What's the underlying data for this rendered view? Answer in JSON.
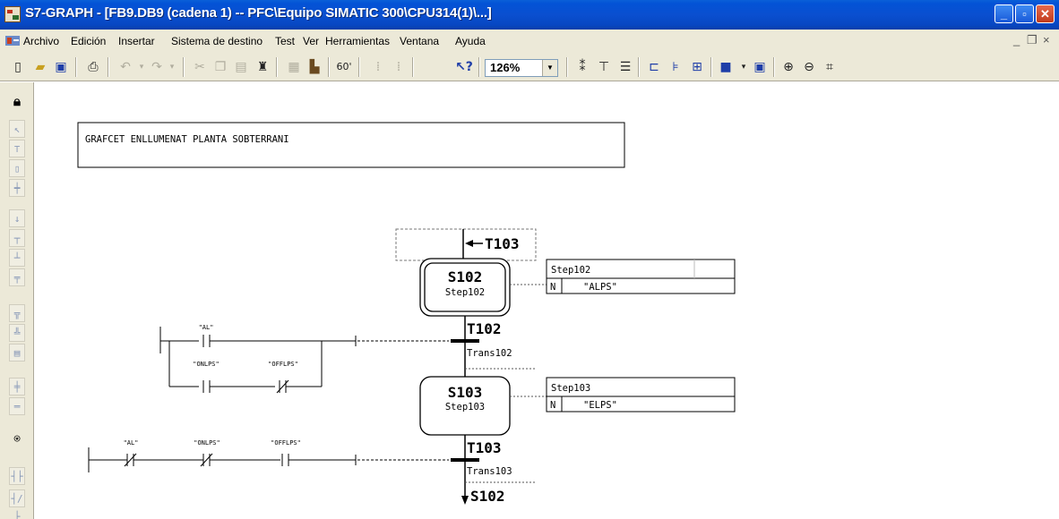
{
  "window": {
    "title": "S7-GRAPH - [FB9.DB9 (cadena 1) -- PFC\\Equipo SIMATIC 300\\CPU314(1)\\...]",
    "buttons": [
      "minimize",
      "maximize",
      "close"
    ]
  },
  "menu": {
    "items": [
      "Archivo",
      "Edición",
      "Insertar",
      "Sistema de destino",
      "Test",
      "Ver",
      "Herramientas",
      "Ventana",
      "Ayuda"
    ]
  },
  "toolbar": {
    "zoom": "126%",
    "icons": [
      "new-icon",
      "open-icon",
      "save-icon",
      "print-icon",
      "undo-icon",
      "redo-icon",
      "cut-icon",
      "copy-icon",
      "paste-icon",
      "find-icon",
      "compile-icon",
      "download-icon",
      "monitor-icon",
      "step-icon",
      "trans-icon",
      "help-icon"
    ]
  },
  "palette": {
    "icons": [
      "lock-icon",
      "select-icon",
      "step-trans-icon",
      "step-icon",
      "trans-icon",
      "jump-icon",
      "branch-open-icon",
      "branch-close-icon",
      "alt-branch-icon",
      "sim-branch-icon",
      "sim-branch-close-icon",
      "comment-icon",
      "nc-contact-icon",
      "no-contact-icon",
      "coil-icon",
      "compare-icon",
      "box-icon",
      "no-contact-2-icon",
      "nc-contact-2-icon"
    ]
  },
  "sequencer": {
    "comment": "GRAFCET ENLLUMENAT PLANTA SOBTERRANI",
    "initial_jump": "T103",
    "steps": [
      {
        "id": "S102",
        "name": "Step102",
        "initial": true,
        "action_title": "Step102",
        "action_qualifier": "N",
        "action_operand": "\"ALPS\""
      },
      {
        "id": "S103",
        "name": "Step103",
        "initial": false,
        "action_title": "Step103",
        "action_qualifier": "N",
        "action_operand": "\"ELPS\""
      }
    ],
    "transitions": [
      {
        "id": "T102",
        "name": "Trans102",
        "contacts": [
          {
            "label": "\"AL\"",
            "type": "NO"
          },
          {
            "label": "\"ONLPS\"",
            "type": "NO"
          },
          {
            "label": "\"OFFLPS\"",
            "type": "NC"
          }
        ]
      },
      {
        "id": "T103",
        "name": "Trans103",
        "contacts": [
          {
            "label": "\"AL\"",
            "type": "NC"
          },
          {
            "label": "\"ONLPS\"",
            "type": "NC"
          },
          {
            "label": "\"OFFLPS\"",
            "type": "NO"
          }
        ]
      }
    ],
    "final_jump": "S102"
  }
}
